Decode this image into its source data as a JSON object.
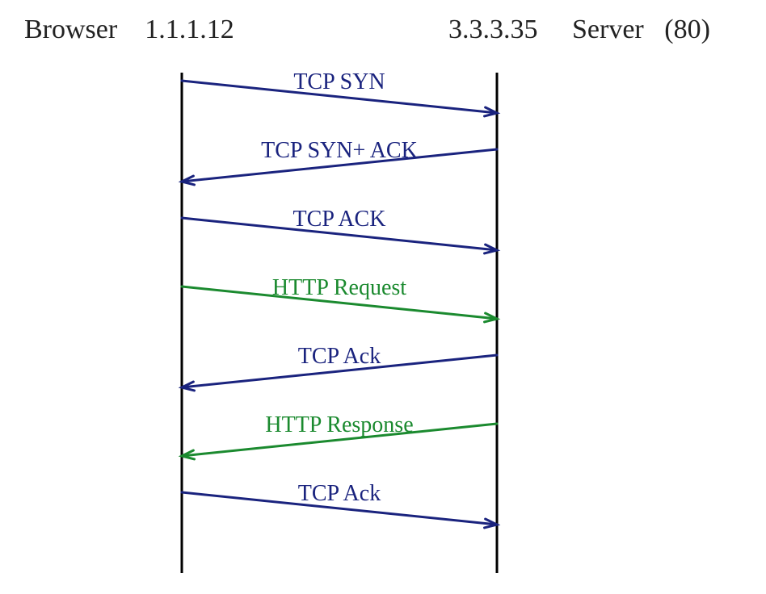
{
  "left_actor": {
    "role": "Browser",
    "address": "1.1.1.12"
  },
  "right_actor": {
    "address": "3.3.3.35",
    "role": "Server",
    "port": "(80)"
  },
  "colors": {
    "tcp": "#1a237e",
    "http": "#1b8a2f",
    "lifeline": "#000000",
    "text": "#222222"
  },
  "messages": [
    {
      "label": "TCP SYN",
      "dir": "right",
      "color_key": "tcp"
    },
    {
      "label": "TCP SYN+ ACK",
      "dir": "left",
      "color_key": "tcp"
    },
    {
      "label": "TCP ACK",
      "dir": "right",
      "color_key": "tcp"
    },
    {
      "label": "HTTP Request",
      "dir": "right",
      "color_key": "http"
    },
    {
      "label": "TCP Ack",
      "dir": "left",
      "color_key": "tcp"
    },
    {
      "label": "HTTP Response",
      "dir": "left",
      "color_key": "http"
    },
    {
      "label": "TCP Ack",
      "dir": "right",
      "color_key": "tcp"
    }
  ],
  "chart_data": {
    "type": "table",
    "title": "TCP/HTTP sequence diagram",
    "left": {
      "role": "Browser",
      "ip": "1.1.1.12"
    },
    "right": {
      "role": "Server",
      "ip": "3.3.3.35",
      "port": 80
    },
    "exchanges": [
      {
        "from": "Browser",
        "to": "Server",
        "label": "TCP SYN",
        "protocol": "TCP"
      },
      {
        "from": "Server",
        "to": "Browser",
        "label": "TCP SYN+ ACK",
        "protocol": "TCP"
      },
      {
        "from": "Browser",
        "to": "Server",
        "label": "TCP ACK",
        "protocol": "TCP"
      },
      {
        "from": "Browser",
        "to": "Server",
        "label": "HTTP Request",
        "protocol": "HTTP"
      },
      {
        "from": "Server",
        "to": "Browser",
        "label": "TCP Ack",
        "protocol": "TCP"
      },
      {
        "from": "Server",
        "to": "Browser",
        "label": "HTTP Response",
        "protocol": "HTTP"
      },
      {
        "from": "Browser",
        "to": "Server",
        "label": "TCP Ack",
        "protocol": "TCP"
      }
    ]
  }
}
